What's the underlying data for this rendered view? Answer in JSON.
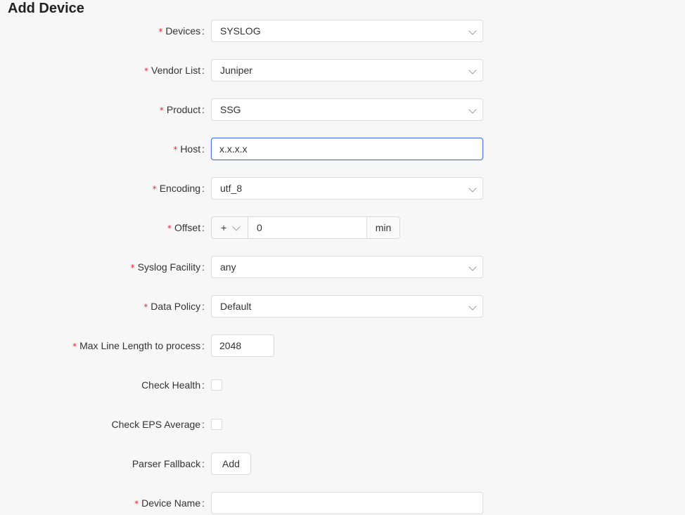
{
  "page": {
    "title": "Add Device"
  },
  "form": {
    "devices": {
      "label": "Devices",
      "value": "SYSLOG"
    },
    "vendor_list": {
      "label": "Vendor List",
      "value": "Juniper"
    },
    "product": {
      "label": "Product",
      "value": "SSG"
    },
    "host": {
      "label": "Host",
      "value": "x.x.x.x"
    },
    "encoding": {
      "label": "Encoding",
      "value": "utf_8"
    },
    "offset": {
      "label": "Offset",
      "sign": "+",
      "value": "0",
      "unit": "min"
    },
    "syslog_facility": {
      "label": "Syslog Facility",
      "value": "any"
    },
    "data_policy": {
      "label": "Data Policy",
      "value": "Default"
    },
    "max_line_length": {
      "label": "Max Line Length to process",
      "value": "2048"
    },
    "check_health": {
      "label": "Check Health",
      "checked": false
    },
    "check_eps_average": {
      "label": "Check EPS Average",
      "checked": false
    },
    "parser_fallback": {
      "label": "Parser Fallback",
      "button_label": "Add"
    },
    "device_name": {
      "label": "Device Name",
      "value": ""
    }
  },
  "required_marker": "*",
  "colon": ":",
  "colors": {
    "required": "#f5222d",
    "focus_border": "#4a74e8",
    "border": "#d9d9d9",
    "background": "#f7f7f7"
  },
  "icons": {
    "select_arrow": "chevron-down-icon"
  }
}
